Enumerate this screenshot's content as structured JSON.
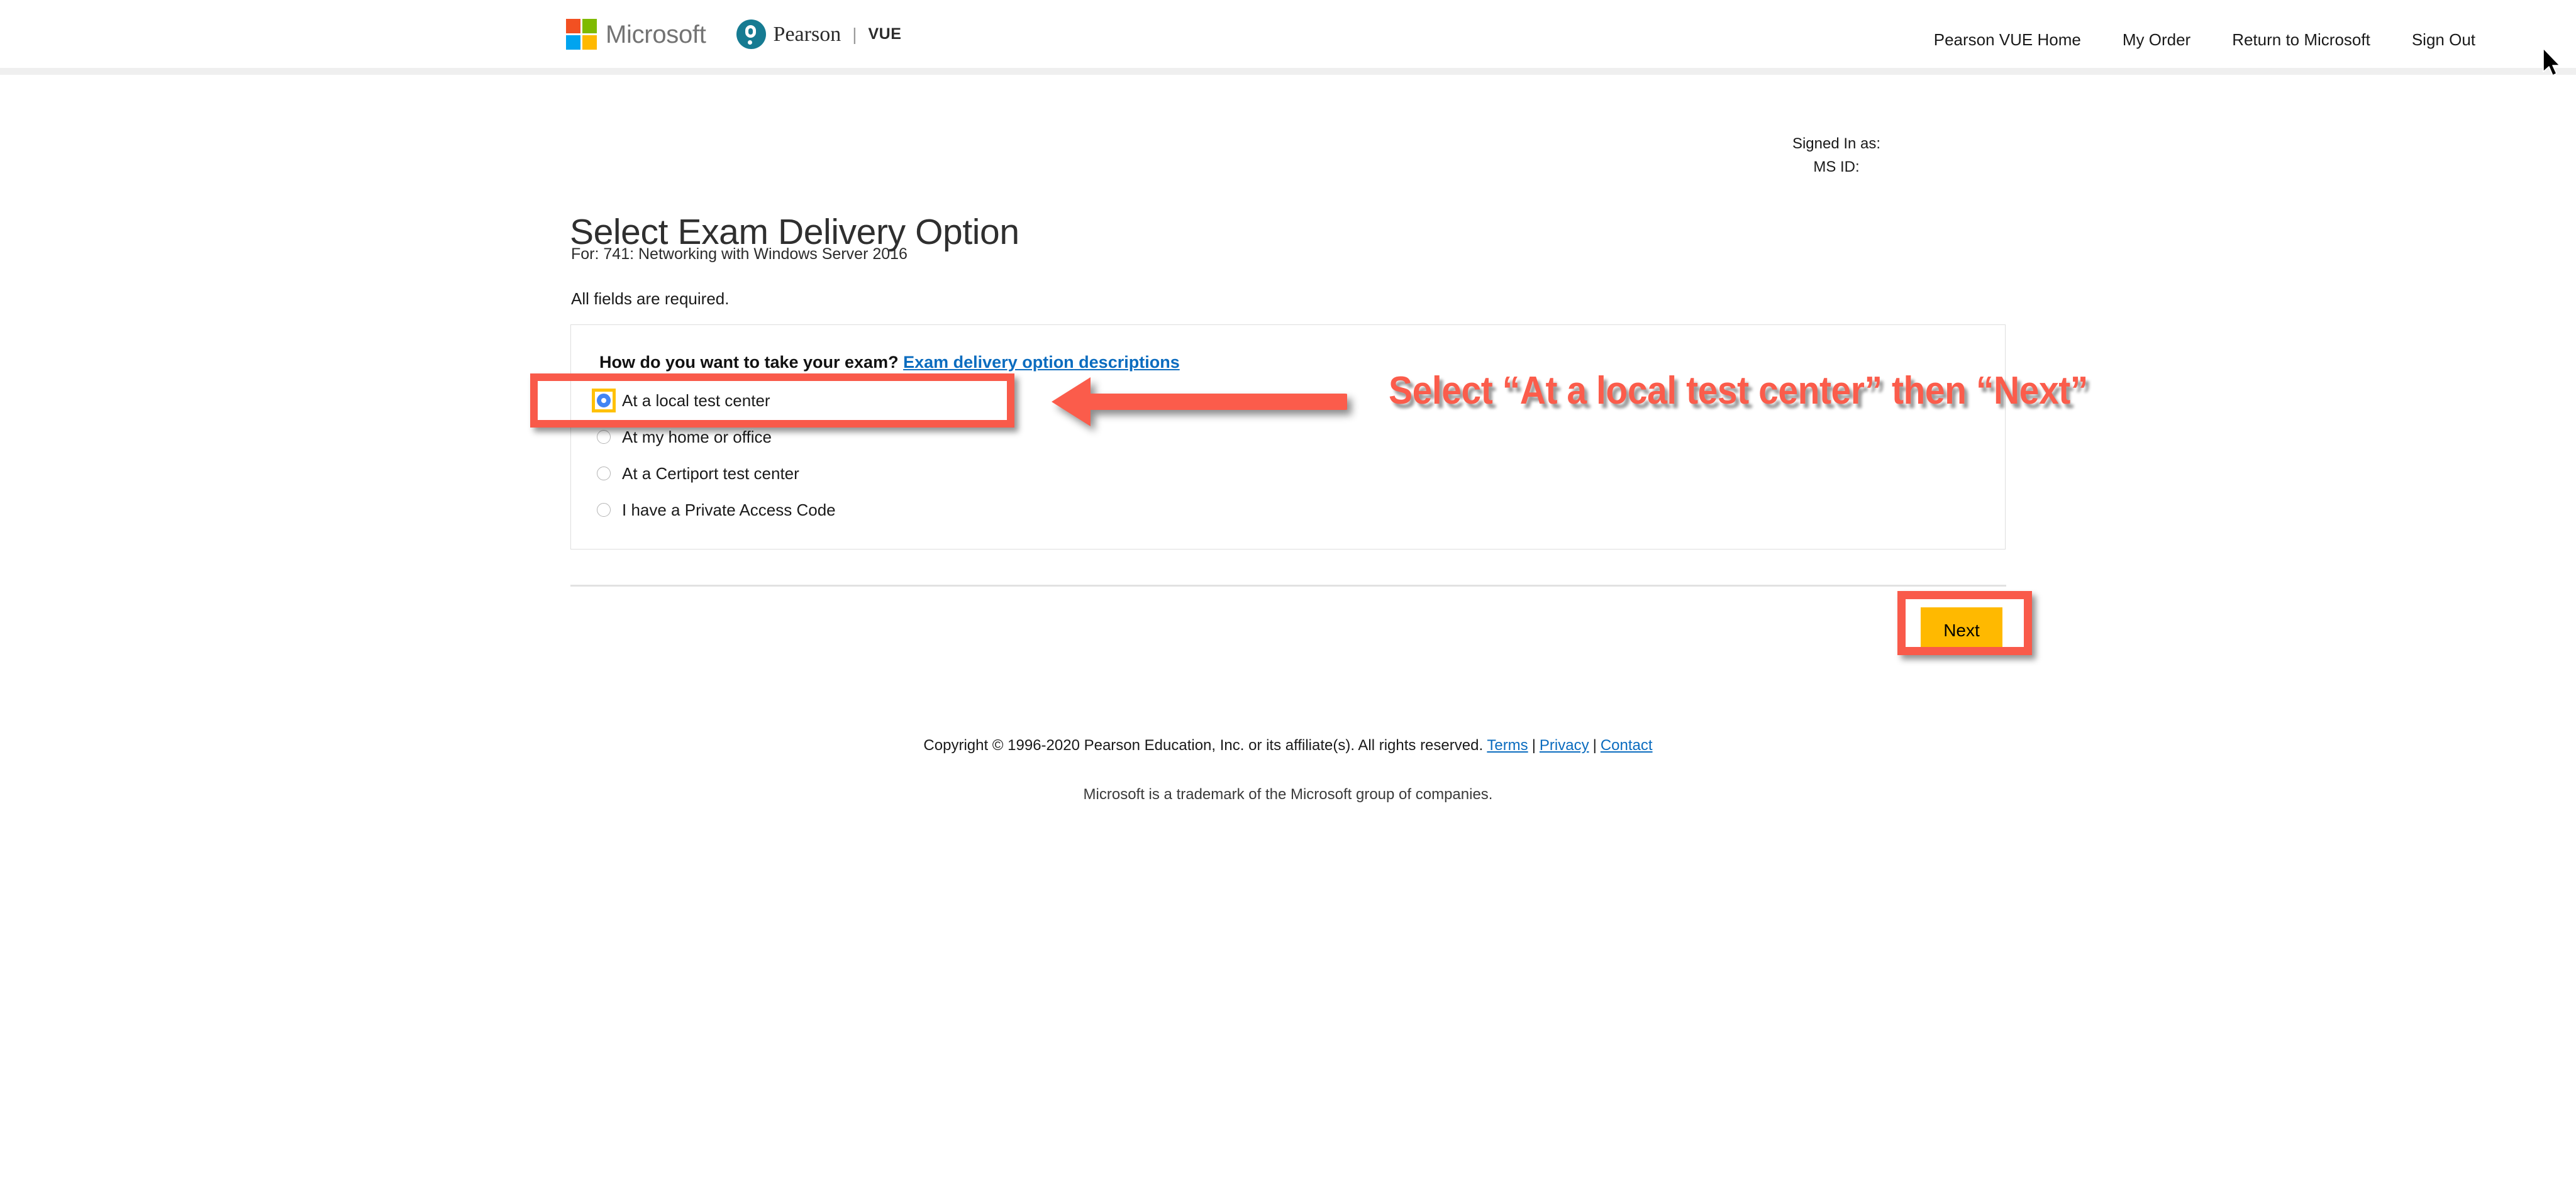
{
  "header": {
    "brand": {
      "microsoft_label": "Microsoft",
      "pearson_label": "Pearson",
      "pearson_separator": "|",
      "pearson_vue_label": "VUE",
      "microsoft_icon": "microsoft-logo-icon",
      "pearson_icon": "pearson-p-mark-icon",
      "colors": {
        "ms_red": "#F25022",
        "ms_green": "#7FBA00",
        "ms_blue": "#00A4EF",
        "ms_yellow": "#FFB900",
        "pearson_teal": "#167B92"
      }
    },
    "nav": [
      {
        "label": "Pearson VUE Home"
      },
      {
        "label": "My Order"
      },
      {
        "label": "Return to Microsoft"
      },
      {
        "label": "Sign Out"
      }
    ]
  },
  "account": {
    "signed_in_label": "Signed In as:",
    "signed_in_value": "",
    "ms_id_label": "MS ID:",
    "ms_id_value": ""
  },
  "main": {
    "title": "Select Exam Delivery Option",
    "subtitle": "For: 741: Networking with Windows Server 2016",
    "required_note": "All fields are required.",
    "panel": {
      "question": "How do you want to take your exam?",
      "question_link": "Exam delivery option descriptions",
      "options": [
        {
          "label": "At a local test center",
          "selected": true
        },
        {
          "label": "At my home or office",
          "selected": false
        },
        {
          "label": "At a Certiport test center",
          "selected": false
        },
        {
          "label": "I have a Private Access Code",
          "selected": false
        }
      ]
    },
    "next_label": "Next",
    "next_color": "#FFB900"
  },
  "footer": {
    "copyright": "Copyright © 1996-2020 Pearson Education, Inc. or its affiliate(s). All rights reserved.",
    "links": [
      {
        "label": "Terms"
      },
      {
        "label": "Privacy"
      },
      {
        "label": "Contact"
      }
    ],
    "separator": "|",
    "trademark": "Microsoft is a trademark of the Microsoft group of companies."
  },
  "annotations": {
    "callout_text": "Select “At a local test center” then “Next”",
    "color": "#FB5C4B",
    "arrow_direction": "left",
    "highlight_targets": [
      "at-a-local-test-center-radio",
      "next-button"
    ]
  }
}
